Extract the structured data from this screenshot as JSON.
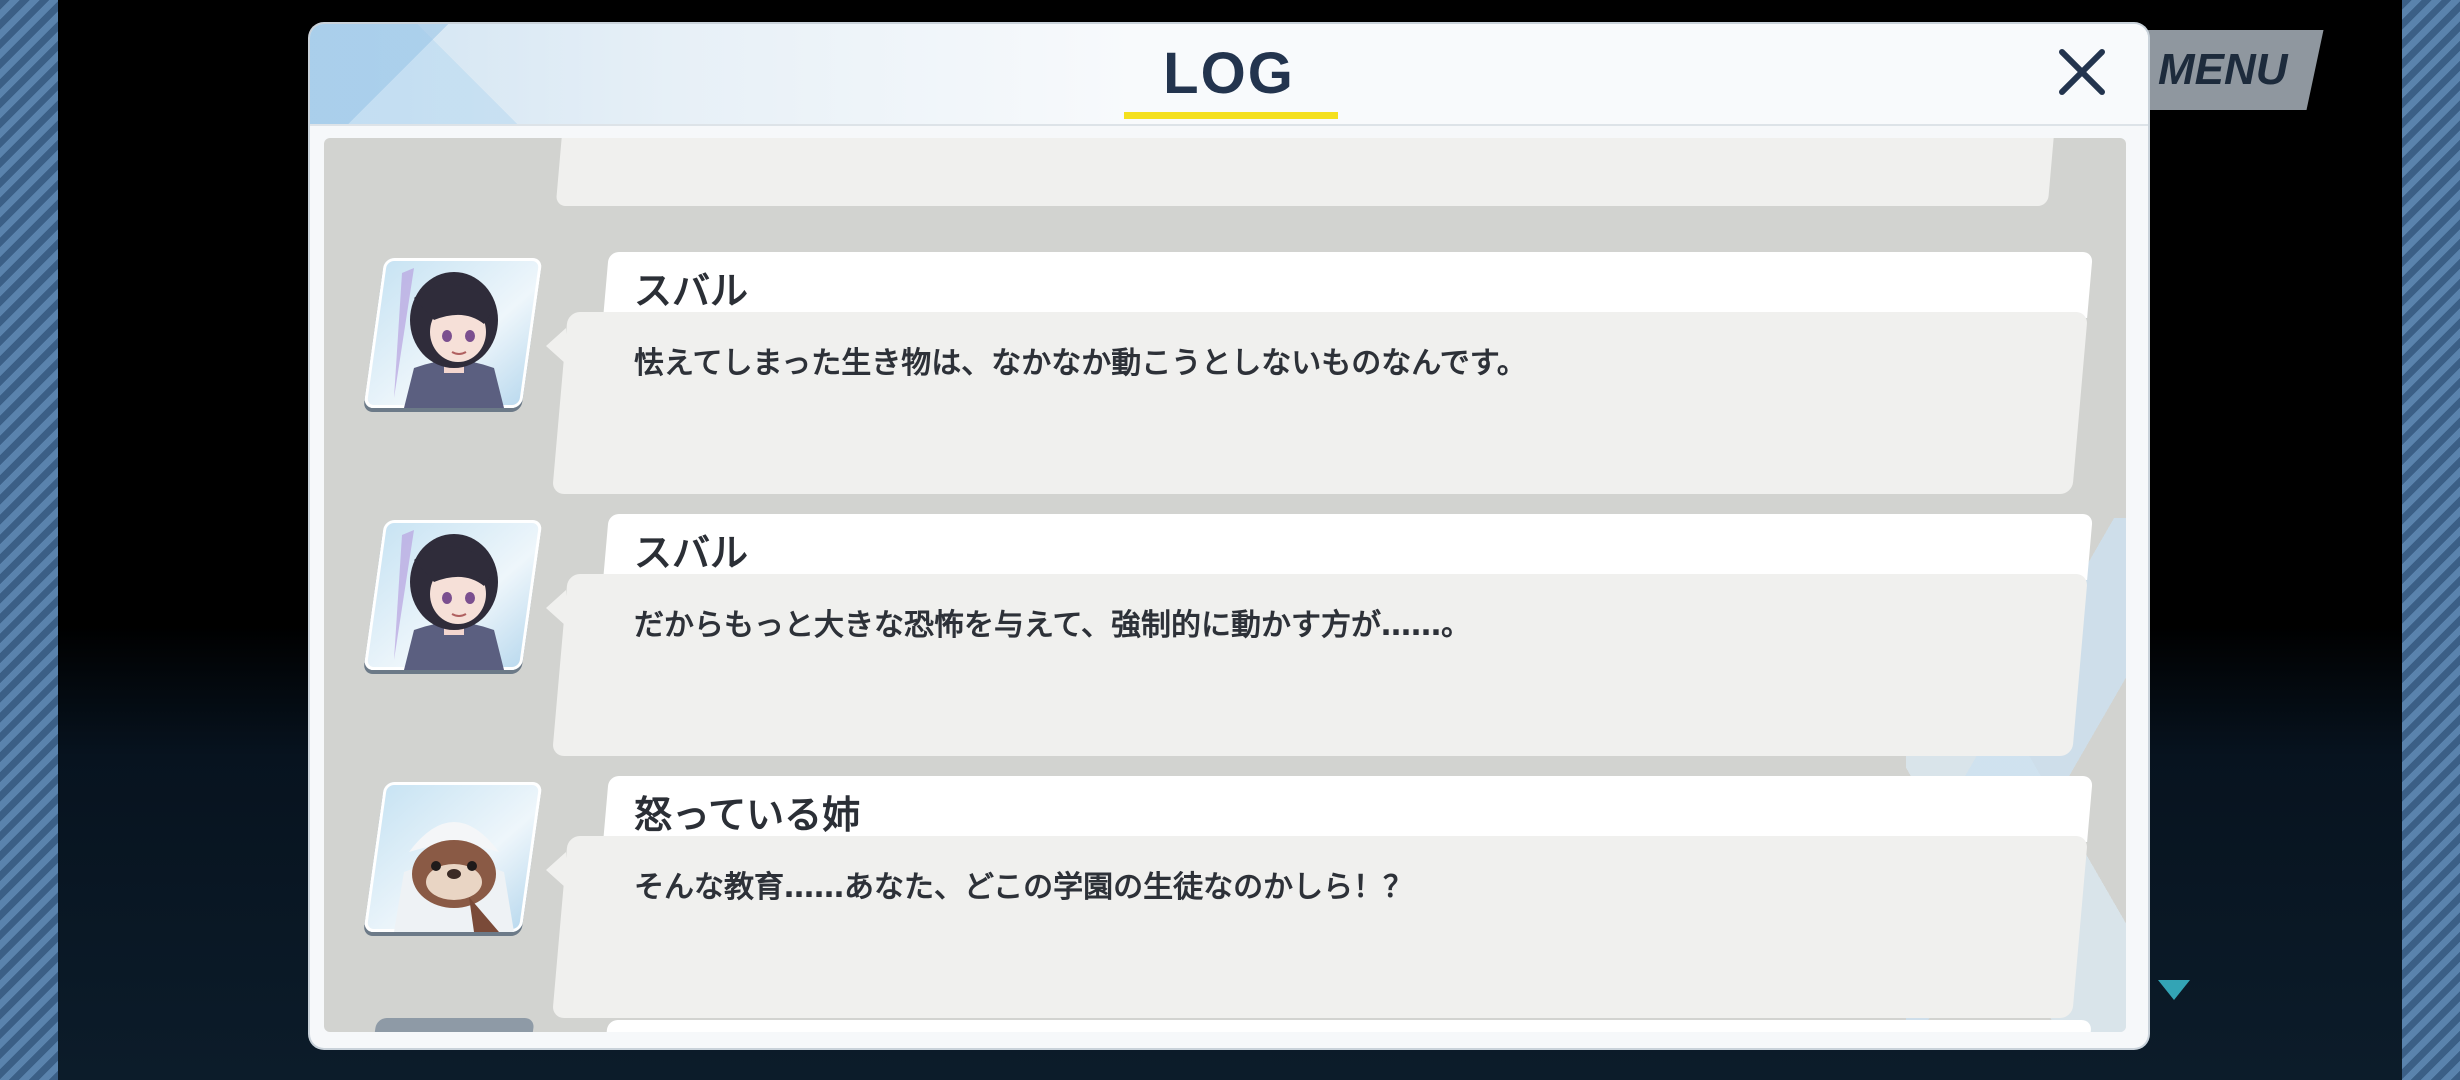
{
  "menu": {
    "label": "MENU"
  },
  "dialog": {
    "title": "LOG",
    "close_icon": "close-icon"
  },
  "log": {
    "entries": [
      {
        "speaker": "スバル",
        "message": "怯えてしまった生き物は、なかなか動こうとしないものなんです。",
        "portrait": "subaru-portrait"
      },
      {
        "speaker": "スバル",
        "message": "だからもっと大きな恐怖を与えて、強制的に動かす方が……。",
        "portrait": "subaru-portrait"
      },
      {
        "speaker": "怒っている姉",
        "message": "そんな教育……あなた、どこの学園の生徒なのかしら！？",
        "portrait": "angry-sister-portrait"
      }
    ]
  },
  "colors": {
    "accent_underline": "#f4e01e",
    "title": "#23344e",
    "next_arrow": "#33a4b5"
  }
}
